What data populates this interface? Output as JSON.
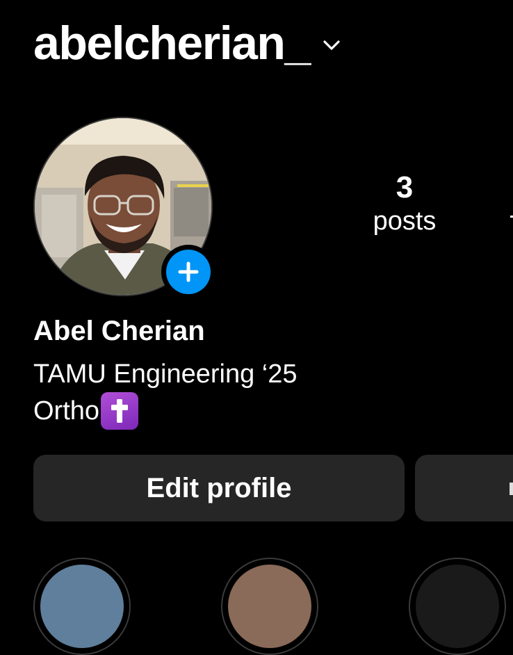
{
  "profile": {
    "username": "abelcherian_",
    "display_name": "Abel Cherian",
    "bio_line1": "TAMU Engineering ‘25",
    "bio_line2": "Ortho"
  },
  "stats": {
    "posts_count": "3",
    "posts_label": "posts"
  },
  "actions": {
    "edit_profile": "Edit profile"
  },
  "icons": {
    "username_dropdown": "chevron-down-icon",
    "add_story": "plus-icon",
    "bio_emoji": "latin-cross-emoji"
  },
  "colors": {
    "background": "#000000",
    "text": "#ffffff",
    "button_bg": "#262626",
    "add_story_blue": "#0095f6",
    "emoji_purple": "#9b3fcf"
  }
}
